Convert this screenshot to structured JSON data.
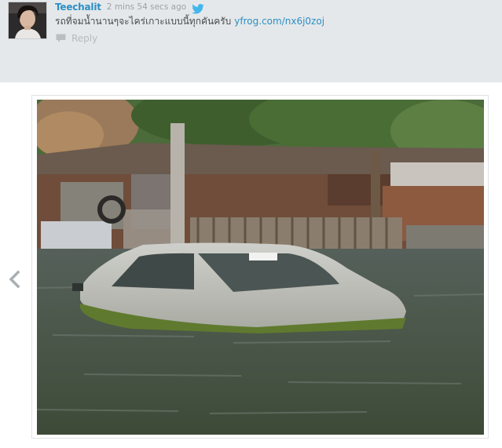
{
  "tweet": {
    "username": "Teechalit",
    "timestamp": "2 mins 54 secs ago",
    "text": "รถที่จมน้ำนานๆจะไคร่เกาะแบบนี้ทุกคันครับ",
    "link": "yfrog.com/nx6j0zoj",
    "reply_label": "Reply",
    "icons": {
      "source": "twitter-bird-icon",
      "reply": "reply-bubble-icon",
      "nav": "chevron-left-icon"
    },
    "colors": {
      "username": "#2b8fc5",
      "link": "#2b8fc5",
      "timestamp": "#9ba2a7",
      "panel": "#e5e8ea"
    }
  }
}
